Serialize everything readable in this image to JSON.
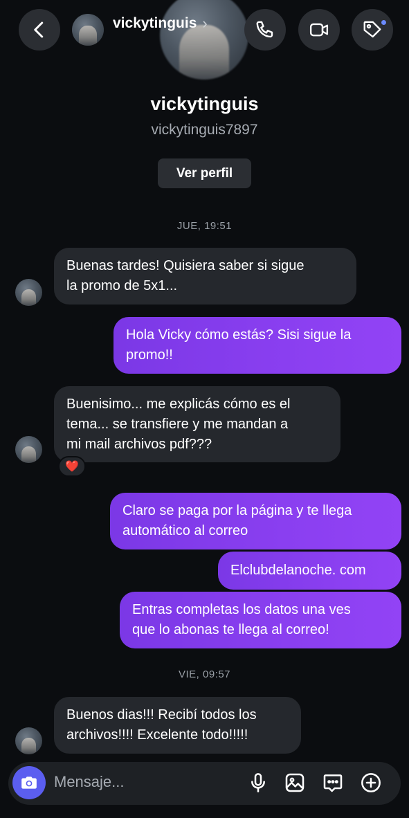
{
  "header": {
    "username": "vickytinguis",
    "chevron": "›",
    "icons": {
      "back": "chevron-left-icon",
      "call": "phone-icon",
      "video": "video-icon",
      "tag": "tag-icon"
    },
    "tag_dot_color": "#6b8bff"
  },
  "profile": {
    "name": "vickytinguis",
    "handle": "vickytinguis7897",
    "view_profile_label": "Ver perfil"
  },
  "conversation": {
    "timestamps": [
      "JUE, 19:51",
      "VIE, 09:57"
    ],
    "messages": [
      {
        "from": "them",
        "lines": [
          "Buenas tardes! Quisiera saber si sigue",
          "la promo de 5x1..."
        ]
      },
      {
        "from": "me",
        "lines": [
          "Hola Vicky cómo estás? Sisi sigue la",
          "promo!!"
        ]
      },
      {
        "from": "them",
        "lines": [
          "Buenisimo... me explicás cómo es el",
          "tema... se transfiere y me mandan a",
          "mi mail archivos pdf???"
        ],
        "reaction": "❤️"
      },
      {
        "from": "me",
        "lines": [
          "Claro se paga por la página y te llega",
          "automático al correo"
        ]
      },
      {
        "from": "me",
        "lines": [
          "Elclubdelanoche. com"
        ]
      },
      {
        "from": "me",
        "lines": [
          "Entras completas los datos una ves",
          "que lo abonas te llega al correo!"
        ]
      },
      {
        "from": "them",
        "lines": [
          "Buenos dias!!! Recibí todos los",
          "archivos!!!! Excelente todo!!!!!"
        ]
      }
    ]
  },
  "composer": {
    "placeholder": "Mensaje...",
    "icons": [
      "camera-icon",
      "microphone-icon",
      "gallery-icon",
      "sticker-icon",
      "plus-circle-icon"
    ],
    "camera_color": "#5b5ef0"
  },
  "colors": {
    "background": "#0b0d10",
    "incoming_bubble": "#25282d",
    "outgoing_bubble": "#8a3ff0"
  }
}
